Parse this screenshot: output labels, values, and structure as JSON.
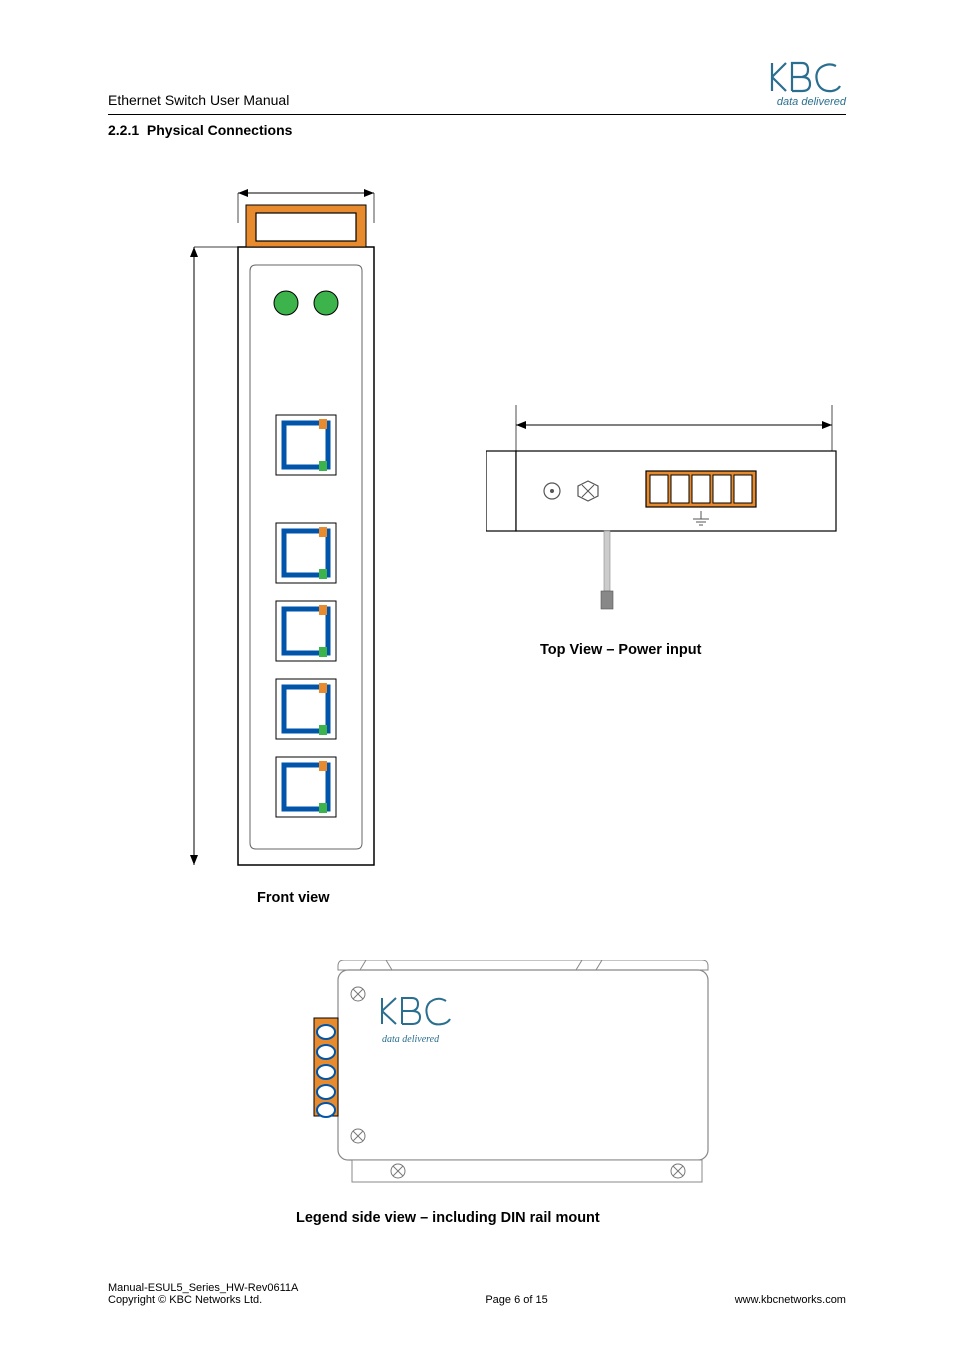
{
  "header": {
    "doc_title": "Ethernet Switch User Manual",
    "logo_sub": "data delivered"
  },
  "section": {
    "number": "2.2.1",
    "title": "Physical Connections"
  },
  "captions": {
    "top_view": "Top View – Power input",
    "front_view": "Front view",
    "side_view": "Legend side view – including DIN rail mount"
  },
  "side_logo_sub": "data delivered",
  "footer": {
    "line1": "Manual-ESUL5_Series_HW-Rev0611A",
    "line2": "Copyright © KBC Networks Ltd.",
    "page": "Page 6 of 15",
    "url": "www.kbcnetworks.com"
  }
}
